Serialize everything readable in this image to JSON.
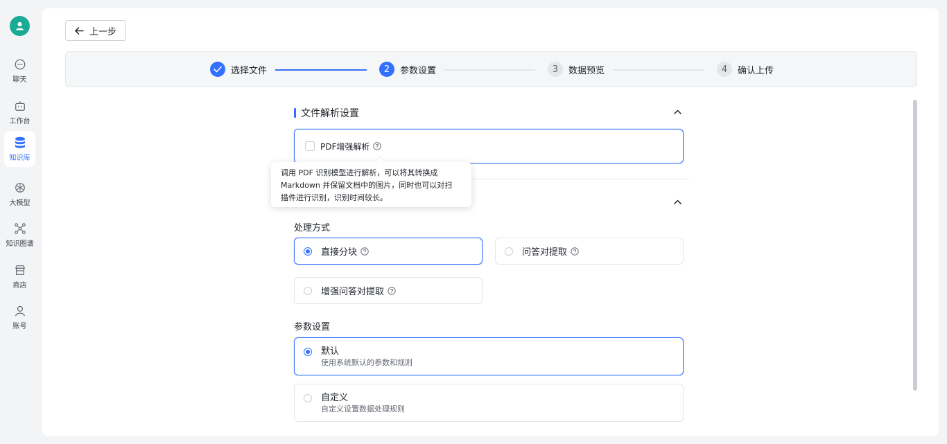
{
  "sidebar": {
    "items": [
      {
        "label": "聊天",
        "icon": "chat-icon"
      },
      {
        "label": "工作台",
        "icon": "robot-icon"
      },
      {
        "label": "知识库",
        "icon": "database-icon",
        "active": true
      },
      {
        "label": "大模型",
        "icon": "model-icon"
      },
      {
        "label": "知识图谱",
        "icon": "graph-icon"
      },
      {
        "label": "商店",
        "icon": "store-icon"
      },
      {
        "label": "账号",
        "icon": "user-icon"
      }
    ]
  },
  "header": {
    "back_label": "上一步"
  },
  "steps": [
    {
      "num": "✓",
      "label": "选择文件",
      "state": "done"
    },
    {
      "num": "2",
      "label": "参数设置",
      "state": "current"
    },
    {
      "num": "3",
      "label": "数据预览",
      "state": "todo"
    },
    {
      "num": "4",
      "label": "确认上传",
      "state": "todo"
    }
  ],
  "file_parse": {
    "title": "文件解析设置",
    "pdf_label": "PDF增强解析",
    "tooltip_line1": "调用 PDF 识别模型进行解析，可以将其转换成",
    "tooltip_line2": "Markdown 并保留文档中的图片，同时也可以对扫",
    "tooltip_line3": "描件进行识别，识别时间较长。"
  },
  "processing": {
    "method_label": "处理方式",
    "methods": [
      {
        "label": "直接分块",
        "selected": true
      },
      {
        "label": "问答对提取",
        "selected": false
      },
      {
        "label": "增强问答对提取",
        "selected": false
      }
    ],
    "params_label": "参数设置",
    "params": [
      {
        "title": "默认",
        "desc": "使用系统默认的参数和规则",
        "selected": true
      },
      {
        "title": "自定义",
        "desc": "自定义设置数据处理规则",
        "selected": false
      }
    ]
  },
  "colors": {
    "accent": "#3370ff",
    "avatar": "#1aab94"
  }
}
